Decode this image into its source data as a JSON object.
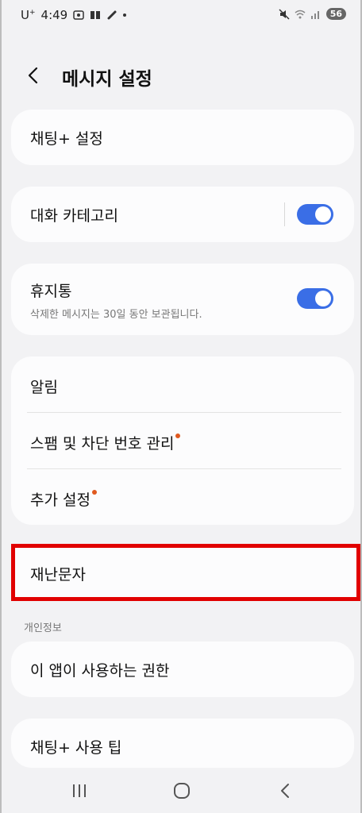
{
  "status_bar": {
    "carrier": "U",
    "carrier_sup": "+",
    "time": "4:49",
    "battery": "56"
  },
  "header": {
    "title": "메시지 설정"
  },
  "items": {
    "chatting_settings": "채팅+ 설정",
    "conversation_category": "대화 카테고리",
    "trash": "휴지통",
    "trash_sub": "삭제한 메시지는 30일 동안 보관됩니다.",
    "notifications": "알림",
    "spam": "스팸 및 차단 번호 관리",
    "more_settings": "추가 설정",
    "emergency_alerts": "재난문자",
    "privacy_header": "개인정보",
    "permissions": "이 앱이 사용하는 권한",
    "chatting_tips": "채팅+ 사용 팁"
  },
  "toggles": {
    "conversation_category": true,
    "trash": true
  },
  "colors": {
    "accent": "#3a6ee6",
    "highlight": "#e10000",
    "badge": "#e0591f"
  }
}
